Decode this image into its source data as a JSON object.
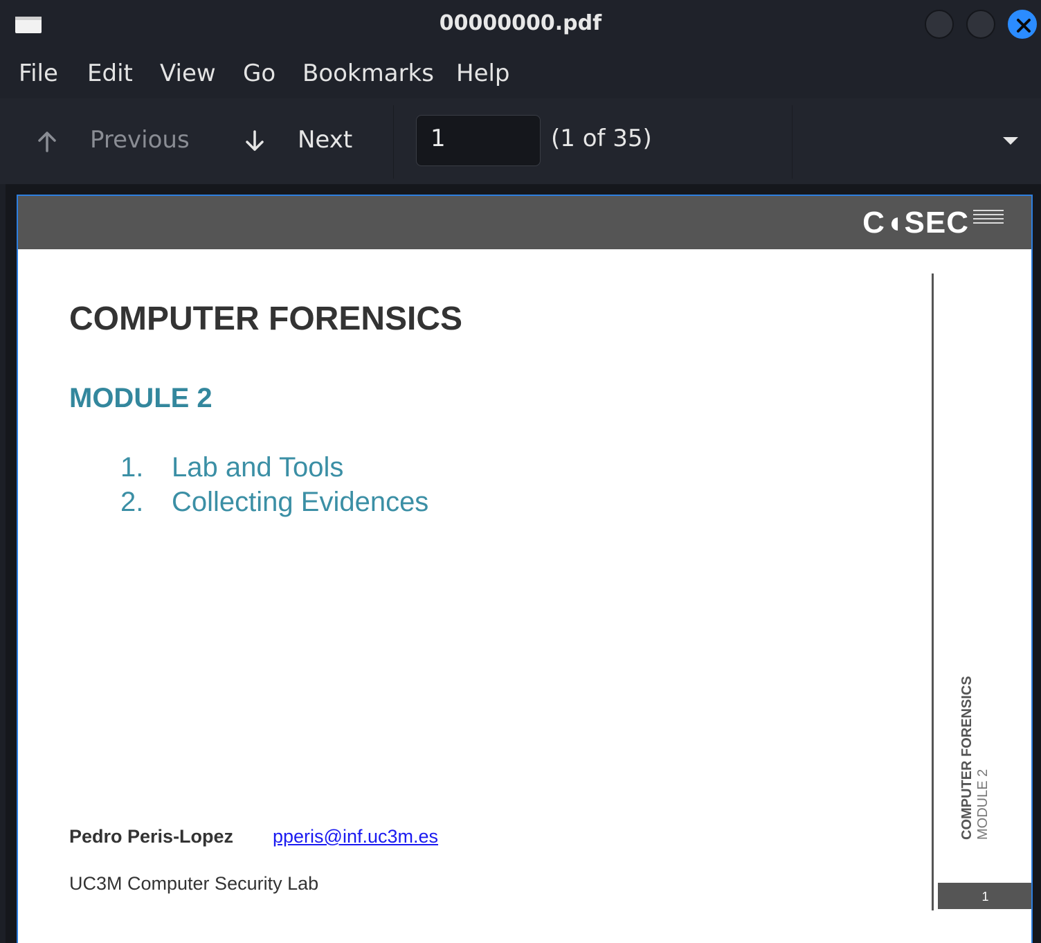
{
  "window": {
    "title": "00000000.pdf"
  },
  "menu": [
    "File",
    "Edit",
    "View",
    "Go",
    "Bookmarks",
    "Help"
  ],
  "toolbar": {
    "previous_label": "Previous",
    "next_label": "Next",
    "page_value": "1",
    "page_count": "(1 of 35)"
  },
  "icons": {
    "previous": "arrow-up-icon",
    "next": "arrow-down-icon",
    "dropdown": "caret-down-icon",
    "close": "close-icon"
  },
  "colors": {
    "close_button": "#2b8cff",
    "page_border": "#2d7fe0",
    "accent_teal": "#33879d",
    "link": "#1a1af0"
  },
  "document": {
    "logo": "C◖SEC",
    "title": "COMPUTER FORENSICS",
    "module": "MODULE 2",
    "toc": [
      {
        "num": "1.",
        "label": "Lab and Tools"
      },
      {
        "num": "2.",
        "label": "Collecting Evidences"
      }
    ],
    "author": "Pedro Peris-Lopez",
    "email": "pperis@inf.uc3m.es",
    "lab": "UC3M Computer Security Lab",
    "side_title": "COMPUTER FORENSICS",
    "side_subtitle": "MODULE 2",
    "page_number": "1"
  }
}
